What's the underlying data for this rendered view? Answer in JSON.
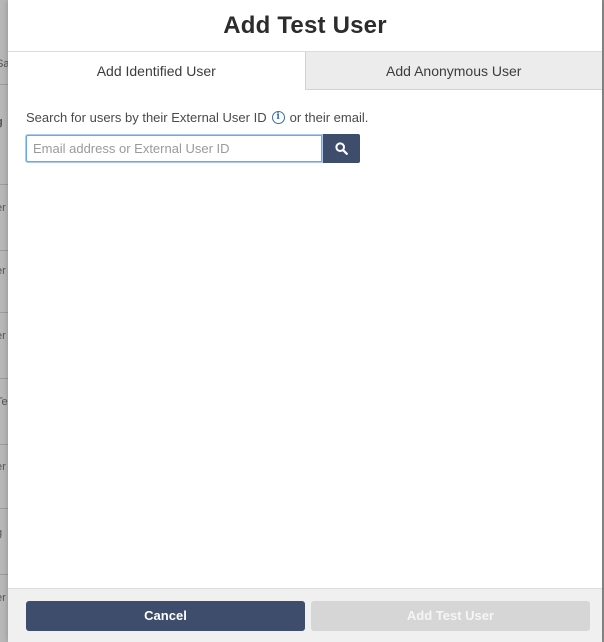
{
  "background": {
    "fragments": [
      "Sa",
      "g",
      "er",
      "er",
      "er",
      "Te",
      "er",
      "g",
      "er"
    ]
  },
  "modal": {
    "title": "Add Test User",
    "tabs": [
      {
        "label": "Add Identified User",
        "active": true
      },
      {
        "label": "Add Anonymous User",
        "active": false
      }
    ],
    "search": {
      "hint_before": "Search for users by their External User ID",
      "hint_after": "or their email.",
      "info_icon": "info-icon",
      "placeholder": "Email address or External User ID",
      "value": "",
      "button_icon": "search-icon"
    },
    "footer": {
      "cancel_label": "Cancel",
      "add_label": "Add Test User",
      "add_disabled": true
    }
  },
  "colors": {
    "primary": "#3d4d6b",
    "disabled": "#d6d6d6",
    "focus": "#6fa8dc"
  }
}
